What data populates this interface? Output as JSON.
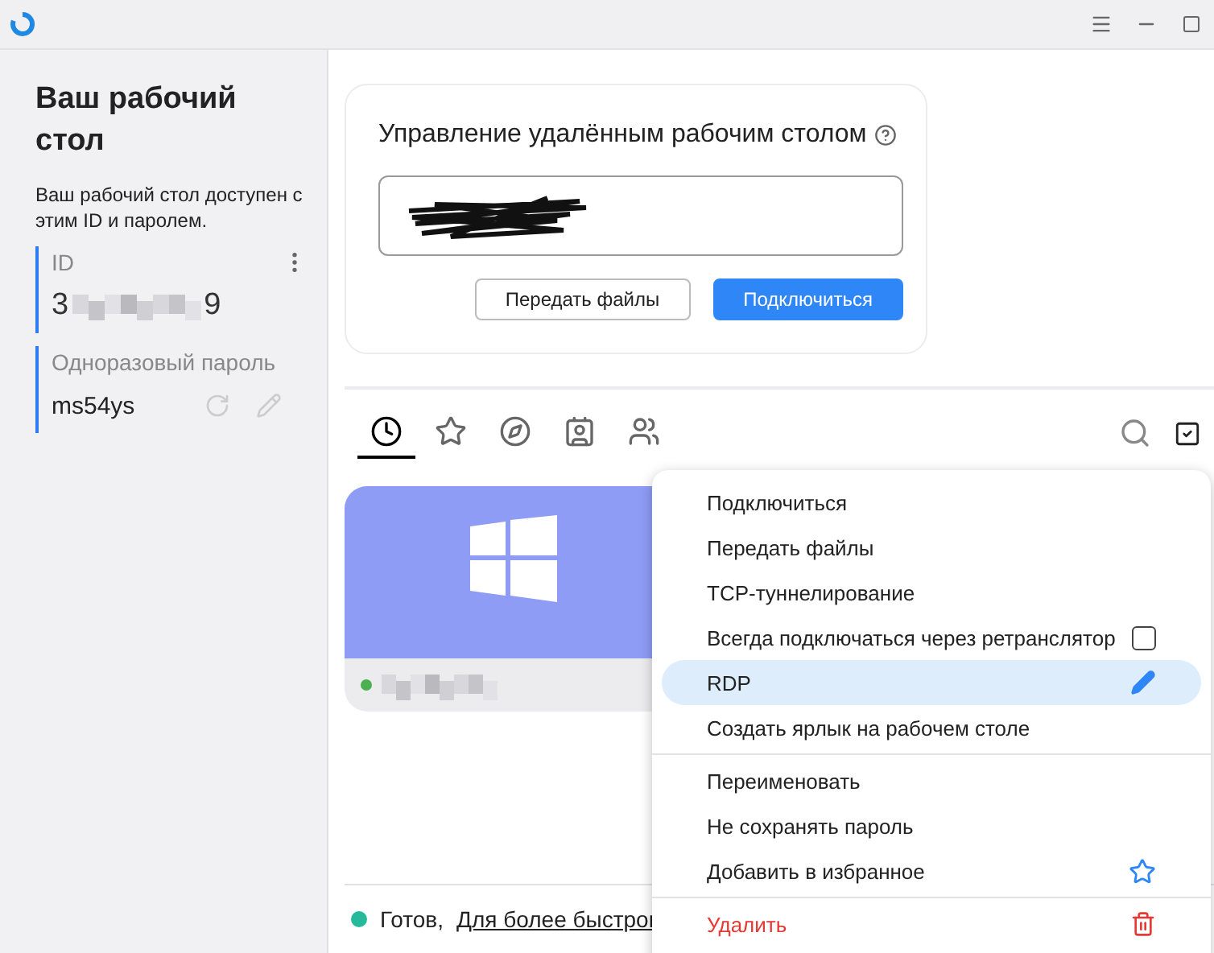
{
  "sidebar": {
    "title": "Ваш рабочий стол",
    "description": "Ваш рабочий стол доступен с этим ID и паролем.",
    "id": {
      "label": "ID",
      "first": "3",
      "last": "9"
    },
    "password": {
      "label": "Одноразовый пароль",
      "value": "ms54ys"
    }
  },
  "remote": {
    "title": "Управление удалённым рабочим столом",
    "buttons": [
      {
        "label": "Передать файлы",
        "primary": false
      },
      {
        "label": "Подключиться",
        "primary": true
      }
    ]
  },
  "tabs": [
    {
      "kind": "recent",
      "selected": true
    },
    {
      "kind": "favorites",
      "selected": false
    },
    {
      "kind": "discovered",
      "selected": false
    },
    {
      "kind": "address-book",
      "selected": false
    },
    {
      "kind": "group",
      "selected": false
    }
  ],
  "peer": {
    "online": true
  },
  "menu": {
    "sections": [
      [
        {
          "label": "Подключиться",
          "kind": "plain",
          "selected": false
        },
        {
          "label": "Передать файлы",
          "kind": "plain",
          "selected": false
        },
        {
          "label": "TCP-туннелирование",
          "kind": "plain",
          "selected": false
        },
        {
          "label": "Всегда подключаться через ретранслятор",
          "kind": "checkbox",
          "checked": false,
          "selected": false
        },
        {
          "label": "RDP",
          "kind": "edit",
          "selected": true
        },
        {
          "label": "Создать ярлык на рабочем столе",
          "kind": "plain",
          "selected": false
        }
      ],
      [
        {
          "label": "Переименовать",
          "kind": "plain",
          "selected": false
        },
        {
          "label": "Не сохранять пароль",
          "kind": "plain",
          "selected": false
        },
        {
          "label": "Добавить в избранное",
          "kind": "favorite",
          "selected": false
        }
      ],
      [
        {
          "label": "Удалить",
          "kind": "delete",
          "selected": false
        }
      ]
    ]
  },
  "status": {
    "ready": true,
    "text": "Готов,",
    "link": "Для более быстрог"
  }
}
